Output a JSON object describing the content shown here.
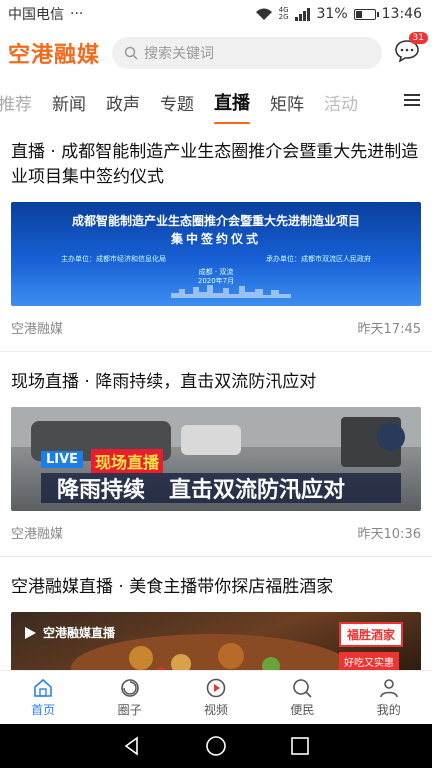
{
  "status_bar": {
    "carrier": "中国电信",
    "dots": "···",
    "network": "4G",
    "network2": "2G",
    "battery": "31%",
    "battery_level": 0.31,
    "time": "13:46"
  },
  "header": {
    "logo": "空港融媒",
    "search_placeholder": "搜索关键词",
    "message_badge": "31"
  },
  "tabs": [
    {
      "label": "推荐"
    },
    {
      "label": "新闻"
    },
    {
      "label": "政声"
    },
    {
      "label": "专题"
    },
    {
      "label": "直播"
    },
    {
      "label": "矩阵"
    },
    {
      "label": "活动"
    }
  ],
  "feed": [
    {
      "title": "直播 · 成都智能制造产业生态圈推介会暨重大先进制造业项目集中签约仪式",
      "image": {
        "line1": "成都智能制造产业生态圈推介会暨重大先进制造业项目",
        "line2": "集中签约仪式",
        "host": "主办单位：成都市经济和信息化局",
        "organizer": "承办单位：成都市双流区人民政府",
        "place": "成都 · 双流",
        "date": "2020年7月"
      },
      "source": "空港融媒",
      "time": "昨天17:45"
    },
    {
      "title": "现场直播 · 降雨持续，直击双流防汛应对",
      "image": {
        "live": "LIVE",
        "tag": "现场直播",
        "caption_left": "降雨持续",
        "caption_right": "直击双流防汛应对"
      },
      "source": "空港融媒",
      "time": "昨天10:36"
    },
    {
      "title": "空港融媒直播 · 美食主播带你探店福胜酒家",
      "image": {
        "brand": "空港融媒直播",
        "shop": "福胜酒家",
        "slogan": "好吃又实惠"
      }
    }
  ],
  "bottom_nav": [
    {
      "label": "首页",
      "icon": "home-icon"
    },
    {
      "label": "圈子",
      "icon": "circle-icon"
    },
    {
      "label": "视频",
      "icon": "video-icon"
    },
    {
      "label": "便民",
      "icon": "search-icon"
    },
    {
      "label": "我的",
      "icon": "user-icon"
    }
  ],
  "colors": {
    "brand": "#f26b1d",
    "active_nav": "#2d7ff2",
    "badge": "#e33333"
  }
}
